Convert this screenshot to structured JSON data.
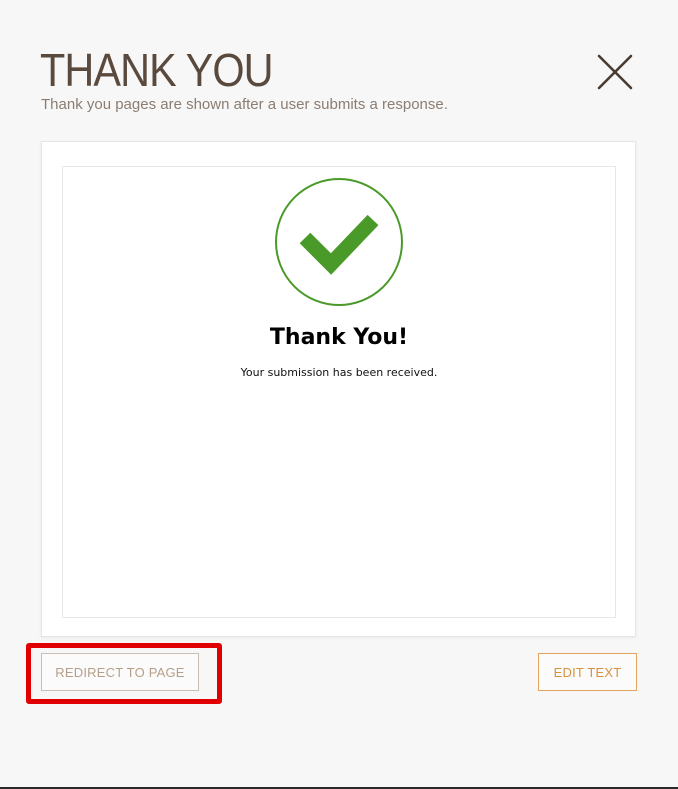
{
  "header": {
    "title": "THANK YOU",
    "subtitle": "Thank you pages are shown after a user submits a response.",
    "close_icon": "close-icon"
  },
  "preview": {
    "icon": "checkmark-circle-icon",
    "heading": "Thank You!",
    "message": "Your submission has been received."
  },
  "actions": {
    "redirect_label": "REDIRECT TO PAGE",
    "edit_text_label": "EDIT TEXT"
  },
  "colors": {
    "title_brown": "#5a4a3e",
    "check_green": "#4a9a2a",
    "highlight_red": "#e10000",
    "edit_orange": "#d9913b"
  }
}
